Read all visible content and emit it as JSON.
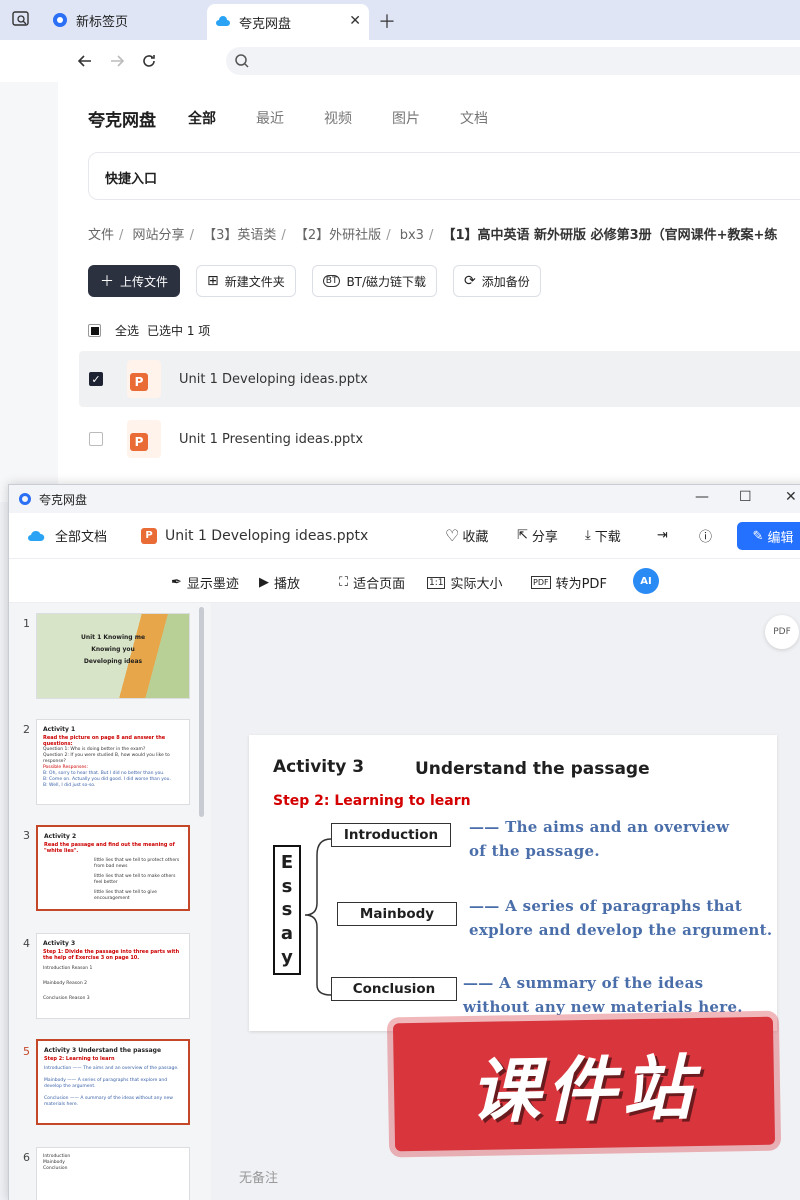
{
  "browser": {
    "tabs": [
      {
        "label": "新标签页",
        "active": false
      },
      {
        "label": "夸克网盘",
        "active": true
      }
    ]
  },
  "pan": {
    "brand": "夸克网盘",
    "nav": [
      "全部",
      "最近",
      "视频",
      "图片",
      "文档"
    ],
    "quick_entry": "快捷入口",
    "breadcrumb": [
      "文件",
      "网站分享",
      "【3】英语类",
      "【2】外研社版",
      "bx3",
      "【1】高中英语 新外研版 必修第3册（官网课件+教案+练"
    ],
    "actions": {
      "upload": "上传文件",
      "new_folder": "新建文件夹",
      "bt": "BT/磁力链下载",
      "backup": "添加备份"
    },
    "select_all": "全选",
    "selected_text": "已选中 1 项",
    "files": [
      {
        "name": "Unit 1 Developing ideas.pptx",
        "checked": true
      },
      {
        "name": "Unit 1 Presenting ideas.pptx",
        "checked": false
      }
    ]
  },
  "viewer": {
    "title": "夸克网盘",
    "all_docs": "全部文档",
    "doc_name": "Unit 1 Developing ideas.pptx",
    "actions": {
      "fav": "收藏",
      "share": "分享",
      "download": "下载",
      "edit": "编辑"
    },
    "toolbar": {
      "ink": "显示墨迹",
      "play": "播放",
      "fit": "适合页面",
      "actual": "实际大小",
      "to_pdf": "转为PDF",
      "ai": "AI"
    },
    "thumbnails": [
      {
        "num": "1",
        "lines": [
          "Unit 1 Knowing me",
          "Knowing you",
          "Developing ideas"
        ]
      },
      {
        "num": "2",
        "title": "Activity 1",
        "red": "Read the picture on page 8 and answer the questions:",
        "lines": [
          "Question 1: Who is doing better in the exam?",
          "Question 2: If you were studied B, how would you like to response?",
          "Possible Responses:",
          "B: Oh, sorry to hear that. But I did no better than you.",
          "B: Come on. Actually you did good. I did worse than you.",
          "B: Well, I did just so-so."
        ]
      },
      {
        "num": "3",
        "title": "Activity 2",
        "red": "Read the passage and find out the meaning of \"white lies\".",
        "lines": [
          "little lies that we tell to protect others from bad news",
          "little lies that we tell to make others feel better",
          "little lies that we tell to give encouragement"
        ]
      },
      {
        "num": "4",
        "title": "Activity 3",
        "red": "Step 1: Divide the passage into three parts with the help of Exercise 3 on page 10.",
        "lines": [
          "Introduction  Reason 1",
          "Mainbody  Reason 2",
          "Conclusion  Reason 3"
        ]
      },
      {
        "num": "5",
        "title": "Activity 3    Understand the passage",
        "red": "Step 2: Learning to learn",
        "lines": [
          "Introduction —— The aims and an overview of the passage.",
          "Mainbody —— A series of paragraphs that explore and develop the argument.",
          "Conclusion —— A summary of the ideas without any new materials here."
        ]
      },
      {
        "num": "6",
        "title": "",
        "red": "",
        "lines": [
          "Introduction",
          "Mainbody",
          "Conclusion"
        ]
      }
    ],
    "slide": {
      "activity": "Activity 3",
      "title": "Understand the passage",
      "step": "Step 2: Learning to learn",
      "essay_letters": [
        "E",
        "s",
        "s",
        "a",
        "y"
      ],
      "parts": [
        {
          "label": "Introduction",
          "desc1": "—— The aims and an overview",
          "desc2": "of the passage."
        },
        {
          "label": "Mainbody",
          "desc1": "—— A series of paragraphs that",
          "desc2": "explore and develop the argument."
        },
        {
          "label": "Conclusion",
          "desc1": "—— A summary of the ideas",
          "desc2": "without any new materials here."
        }
      ]
    },
    "no_remark": "无备注",
    "watermark": "课件站"
  },
  "colors": {
    "accent": "#2571ff",
    "ppt": "#e96b35",
    "highlight": "#c5472a",
    "step_red": "#d40000",
    "desc_blue": "#4a6ea9",
    "watermark": "#d8353d"
  }
}
